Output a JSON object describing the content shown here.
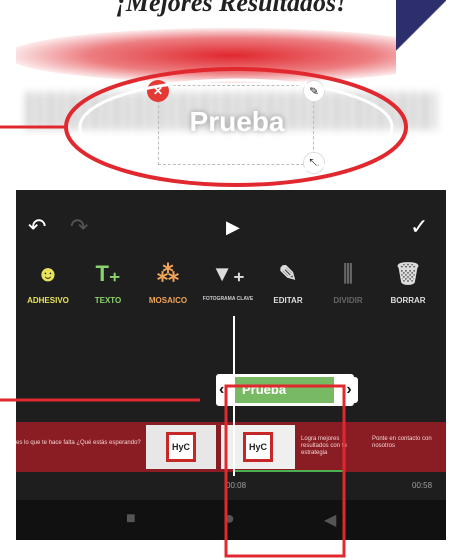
{
  "header": {
    "headline": "¡Mejores Resultados!"
  },
  "sticker": {
    "text": "Prueba"
  },
  "controls": {
    "close_glyph": "✕",
    "edit_glyph": "✎",
    "resize_glyph": "⤡"
  },
  "toolbar": {
    "undo_glyph": "↶",
    "redo_glyph": "↷",
    "play_glyph": "▶",
    "confirm_glyph": "✓"
  },
  "tools": [
    {
      "label": "ADHESIVO",
      "icon": "sticker-icon",
      "glyph": "☻"
    },
    {
      "label": "TEXTO",
      "icon": "text-icon",
      "glyph": "T₊"
    },
    {
      "label": "MOSAICO",
      "icon": "mosaic-icon",
      "glyph": "⁂"
    },
    {
      "label": "FOTOGRAMA CLAVE",
      "icon": "keyframe-icon",
      "glyph": "▼₊"
    },
    {
      "label": "EDITAR",
      "icon": "pencil-icon",
      "glyph": "✎"
    },
    {
      "label": "DIVIDIR",
      "icon": "split-icon",
      "glyph": "⫼"
    },
    {
      "label": "BORRAR",
      "icon": "trash-icon",
      "glyph": "🗑"
    }
  ],
  "timeline": {
    "clip_label": "Prueba",
    "clip_left_glyph": "‹",
    "clip_right_glyph": "›",
    "strip_text_1": "es lo que te hace falta ¿Qué estás esperando?",
    "strip_text_3": "Logra mejores resultados con tu estrategia",
    "strip_text_4": "Ponte en contacto con nosotros",
    "logo_text": "HyC",
    "time_current": "00:08",
    "time_total": "00:58"
  },
  "nav": {
    "recents_glyph": "■",
    "home_glyph": "●",
    "back_glyph": "◀"
  },
  "colors": {
    "annotation_red": "#e0282e",
    "clip_green": "#78b964",
    "dark_bg": "#1e1e1e"
  }
}
